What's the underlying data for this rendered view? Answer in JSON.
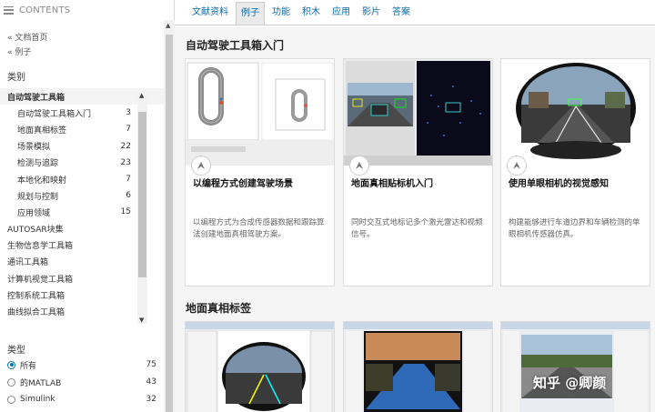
{
  "sidebar": {
    "header": "CONTENTS",
    "breadcrumbs": [
      "« 文档首页",
      "« 例子"
    ],
    "category_title": "类别",
    "categories": [
      {
        "label": "自动驾驶工具箱",
        "count": ""
      },
      {
        "label": "自动驾驶工具箱入门",
        "count": "3"
      },
      {
        "label": "地面真相标签",
        "count": "7"
      },
      {
        "label": "场景模拟",
        "count": "22"
      },
      {
        "label": "检测与追踪",
        "count": "23"
      },
      {
        "label": "本地化和映射",
        "count": "7"
      },
      {
        "label": "规划与控制",
        "count": "6"
      },
      {
        "label": "应用领域",
        "count": "15"
      },
      {
        "label": "AUTOSAR块集",
        "count": ""
      },
      {
        "label": "生物信息学工具箱",
        "count": ""
      },
      {
        "label": "通讯工具箱",
        "count": ""
      },
      {
        "label": "计算机视觉工具箱",
        "count": ""
      },
      {
        "label": "控制系统工具箱",
        "count": ""
      },
      {
        "label": "曲线拟合工具箱",
        "count": ""
      }
    ],
    "type_title": "类型",
    "types": [
      {
        "label": "所有",
        "count": "75"
      },
      {
        "label": "的MATLAB",
        "count": "43"
      },
      {
        "label": "Simulink",
        "count": "32"
      }
    ]
  },
  "tabs": [
    "文献资料",
    "例子",
    "功能",
    "积木",
    "应用",
    "影片",
    "答案"
  ],
  "sections": [
    {
      "title": "自动驾驶工具箱入门",
      "cards": [
        {
          "title": "以编程方式创建驾驶场景",
          "desc": "以编程方式为合成传感器数据和跟踪算法创建地面真相驾驶方案。"
        },
        {
          "title": "地面真相贴标机入门",
          "desc": "同时交互式地标记多个激光雷达和视频信号。"
        },
        {
          "title": "使用单眼相机的视觉感知",
          "desc": "构建能够进行车道边界和车辆检测的单眼相机传感器仿真。"
        }
      ]
    },
    {
      "title": "地面真相标签",
      "cards": [
        {
          "title": ""
        },
        {
          "title": ""
        },
        {
          "title": ""
        }
      ]
    }
  ],
  "watermark": "知乎 @卿颜",
  "colors": {
    "link": "#0b6ca8",
    "accent": "#0076a8"
  }
}
